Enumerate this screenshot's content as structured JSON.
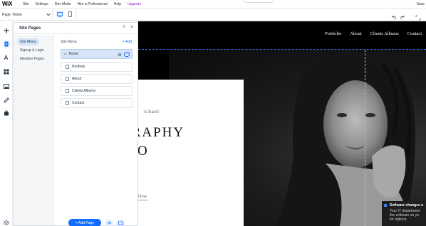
{
  "topbar": {
    "logo": "WiX",
    "menu": [
      "Site",
      "Settings",
      "Dev Mode",
      "Hire a Professional",
      "Help",
      "Upgrade"
    ],
    "save_label": "Save"
  },
  "subbar": {
    "page_select": "Page: Home"
  },
  "rail": {
    "icons": [
      "add-elements-icon",
      "pages-icon",
      "design-icon",
      "apps-icon",
      "media-icon",
      "blog-icon",
      "store-icon",
      "layers-icon"
    ]
  },
  "panel": {
    "title": "Site Pages",
    "help": "?",
    "close": "×",
    "tabs": [
      "Site Menu",
      "Signup & Login",
      "Member Pages"
    ],
    "menu_label": "Site Menu",
    "add_label": "+ Add",
    "pages": [
      "Home",
      "Portfolio",
      "About",
      "Clients Albums",
      "Contact"
    ],
    "add_page_label": "+ Add Page"
  },
  "site": {
    "nav": [
      "Portfolio",
      "About",
      "Clients Albums",
      "Contact"
    ],
    "name_fragment": "ichael",
    "headline_1": "GRAPHY",
    "headline_2": "DIO",
    "cta": "Now"
  },
  "notification": {
    "title": "Software changes a",
    "body": "Your IT department the software on yo for options."
  },
  "colors": {
    "accent": "#116dff",
    "upgrade": "#9a27d5",
    "selected_row": "#d7e4f7"
  }
}
